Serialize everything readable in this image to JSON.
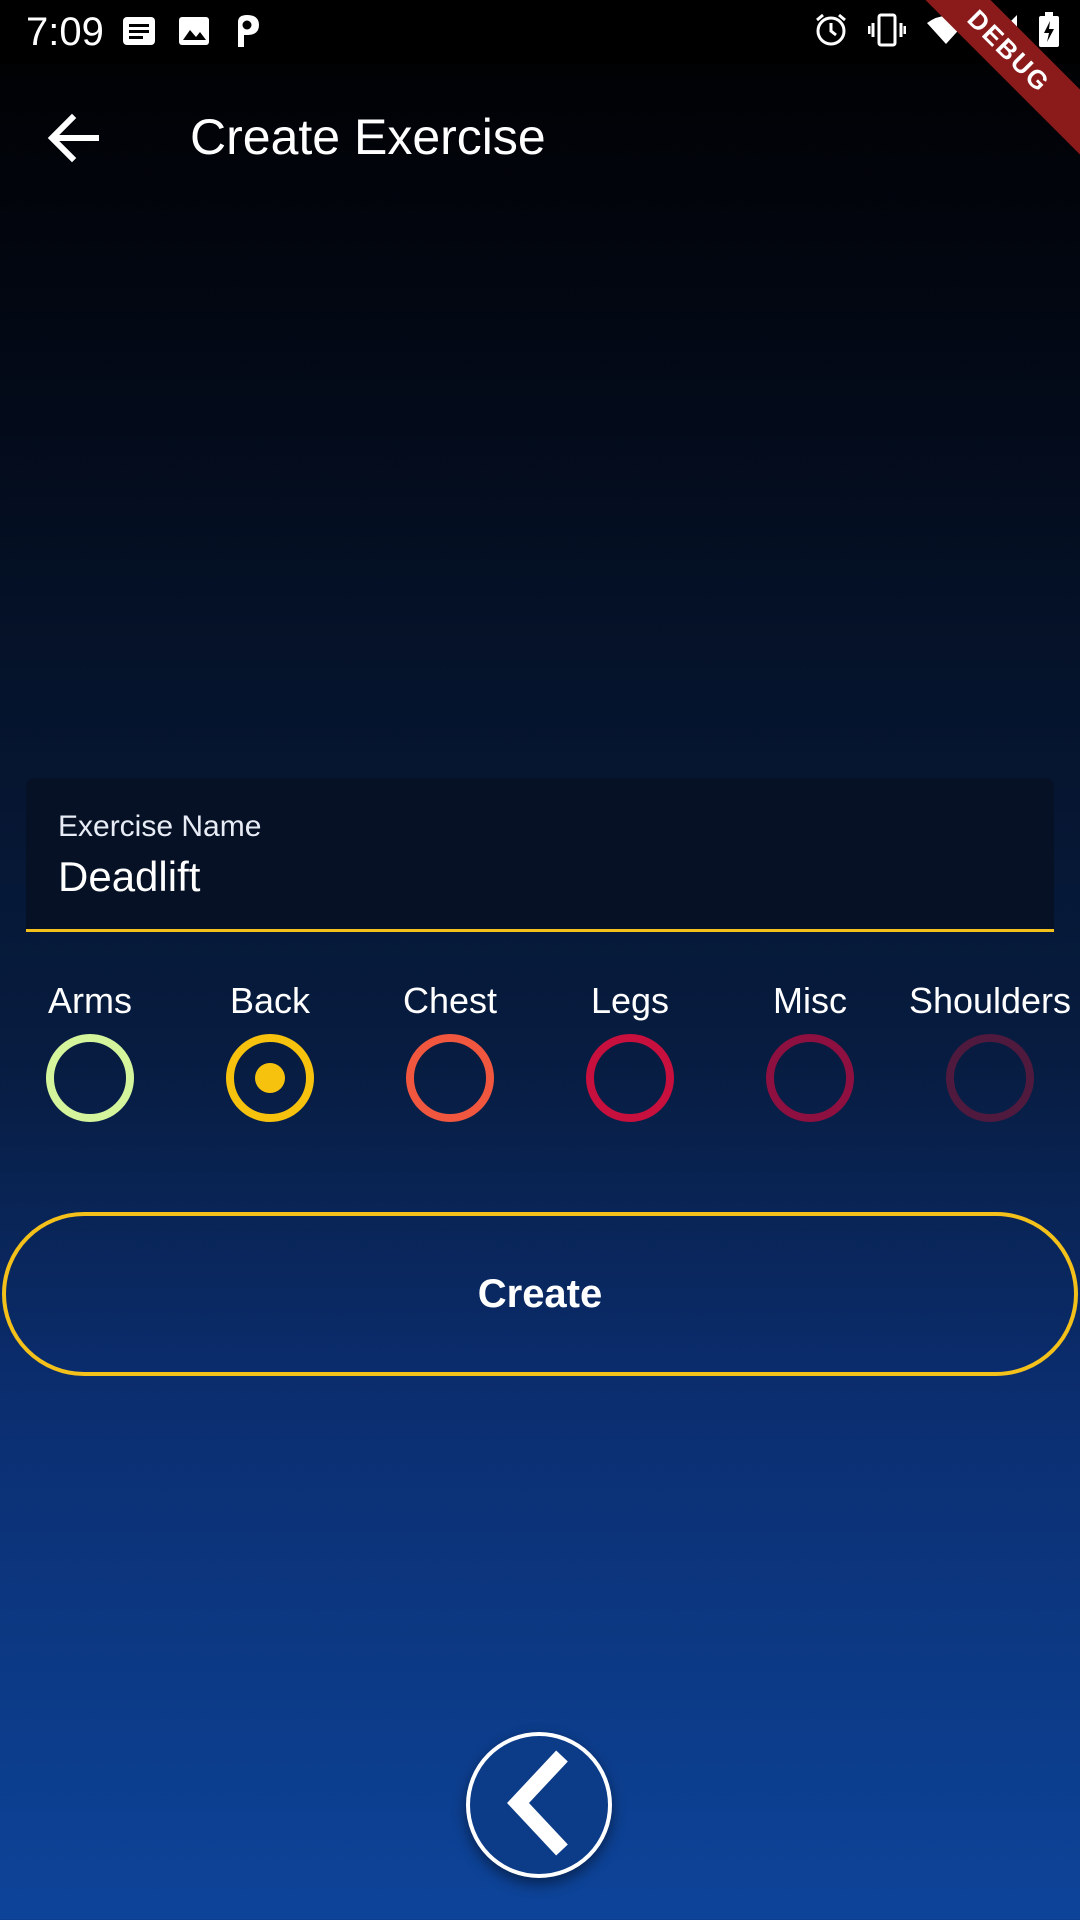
{
  "status_bar": {
    "time": "7:09",
    "left_icons": [
      "notes-icon",
      "image-icon",
      "parking-icon"
    ],
    "right_icons": [
      "alarm-icon",
      "vibrate-icon",
      "wifi-icon",
      "signal-icon",
      "battery-charging-icon"
    ],
    "debug_label": "DEBUG"
  },
  "app_bar": {
    "title": "Create Exercise",
    "back_icon": "arrow-back-icon"
  },
  "form": {
    "name_label": "Exercise Name",
    "name_value": "Deadlift",
    "underline_color": "#f4c11a"
  },
  "categories": [
    {
      "label": "Arms",
      "color": "#d4f59c",
      "selected": false
    },
    {
      "label": "Back",
      "color": "#f7c20d",
      "selected": true
    },
    {
      "label": "Chest",
      "color": "#f1573f",
      "selected": false
    },
    {
      "label": "Legs",
      "color": "#c8103e",
      "selected": false
    },
    {
      "label": "Misc",
      "color": "#8e1040",
      "selected": false
    },
    {
      "label": "Shoulders",
      "color": "#4f1a3e",
      "selected": false
    }
  ],
  "create_button": {
    "label": "Create",
    "border_color": "#f4c11a"
  },
  "fab": {
    "icon": "chevron-left-icon"
  }
}
